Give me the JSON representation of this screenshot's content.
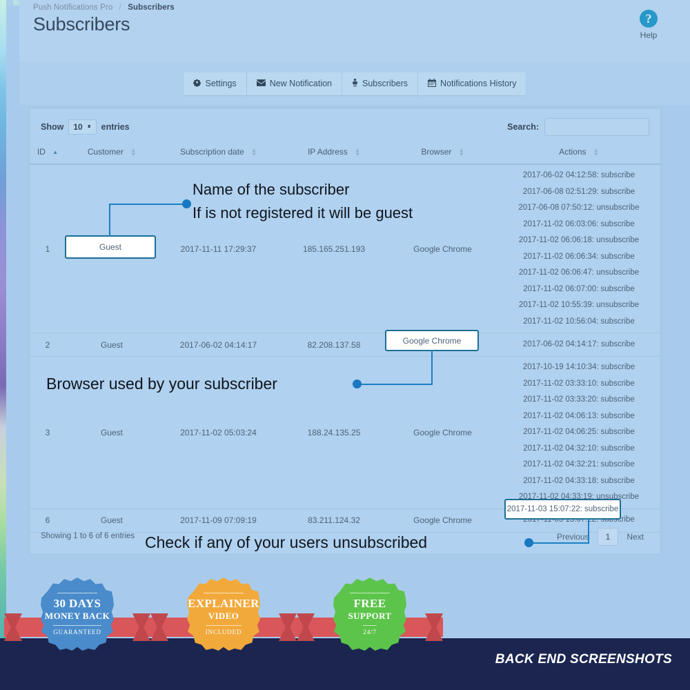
{
  "header": {
    "breadcrumb_parent": "Push Notifications Pro",
    "breadcrumb_sep": "/",
    "breadcrumb_current": "Subscribers",
    "title": "Subscribers",
    "help_glyph": "?",
    "help_label": "Help"
  },
  "toolbar": {
    "tabs": [
      {
        "label": "Settings",
        "icon": "gear-icon",
        "glyph": "⚙"
      },
      {
        "label": "New Notification",
        "icon": "envelope-icon",
        "glyph": "✉"
      },
      {
        "label": "Subscribers",
        "icon": "person-icon",
        "glyph": "!"
      },
      {
        "label": "Notifications History",
        "icon": "calendar-icon",
        "glyph": "☷"
      }
    ]
  },
  "table_controls": {
    "show_label": "Show",
    "entries_label": "entries",
    "page_length": "10",
    "search_label": "Search:",
    "search_value": "",
    "search_placeholder": ""
  },
  "table": {
    "columns": [
      {
        "label": "ID",
        "sort": "asc"
      },
      {
        "label": "Customer",
        "sort": "none"
      },
      {
        "label": "Subscription date",
        "sort": "none"
      },
      {
        "label": "IP Address",
        "sort": "none"
      },
      {
        "label": "Browser",
        "sort": "none"
      },
      {
        "label": "Actions",
        "sort": "none"
      }
    ],
    "rows": [
      {
        "id": "1",
        "customer": "Guest",
        "subscription_date": "2017-11-11 17:29:37",
        "ip": "185.165.251.193",
        "browser": "Google Chrome",
        "actions": [
          "2017-06-02 04:12:58: subscribe",
          "2017-06-08 02:51:29: subscribe",
          "2017-06-08 07:50:12: unsubscribe",
          "2017-11-02 06:03:06: subscribe",
          "2017-11-02 06:06:18: unsubscribe",
          "2017-11-02 06:06:34: subscribe",
          "2017-11-02 06:06:47: unsubscribe",
          "2017-11-02 06:07:00: subscribe",
          "2017-11-02 10:55:39: unsubscribe",
          "2017-11-02 10:56:04: subscribe"
        ]
      },
      {
        "id": "2",
        "customer": "Guest",
        "subscription_date": "2017-06-02 04:14:17",
        "ip": "82.208.137.58",
        "browser": "Google Chrome",
        "actions": [
          "2017-06-02 04:14:17: subscribe"
        ]
      },
      {
        "id": "3",
        "customer": "Guest",
        "subscription_date": "2017-11-02 05:03:24",
        "ip": "188.24.135.25",
        "browser": "Google Chrome",
        "actions": [
          "2017-10-19 14:10:34: subscribe",
          "2017-11-02 03:33:10: subscribe",
          "2017-11-02 03:33:20: subscribe",
          "2017-11-02 04:06:13: subscribe",
          "2017-11-02 04:06:25: subscribe",
          "2017-11-02 04:32:10: subscribe",
          "2017-11-02 04:32:21: subscribe",
          "2017-11-02 04:33:18: subscribe",
          "2017-11-02 04:33:19: unsubscribe"
        ]
      },
      {
        "id": "6",
        "customer": "Guest",
        "subscription_date": "2017-11-09 07:09:19",
        "ip": "83.211.124.32",
        "browser": "Google Chrome",
        "actions": [
          "2017-11-03 15:07:22: subscribe"
        ]
      }
    ]
  },
  "footer": {
    "showing": "Showing 1 to 6 of 6 entries",
    "previous": "Previous",
    "page_one": "1",
    "next": "Next"
  },
  "annotations": {
    "callout_customer_line1": "Name of the subscriber",
    "callout_customer_line2": "If is not registered it will be guest",
    "callout_browser": "Browser used by your subscriber",
    "callout_actions": "Check if any of your users unsubscribed",
    "highlight_customer_value": "Guest",
    "highlight_browser_value": "Google Chrome",
    "highlight_action_value": "2017-11-03 15:07:22: subscribe"
  },
  "promo": {
    "caption": "BACK END SCREENSHOTS",
    "badges": [
      {
        "line1": "30 DAYS",
        "line2": "MONEY BACK",
        "line3": "GUARANTEED",
        "color": "#4a8ccb"
      },
      {
        "line1": "EXPLAINER",
        "line2": "VIDEO",
        "line3": "INCLUDED",
        "color": "#f2a93b"
      },
      {
        "line1": "FREE",
        "line2": "SUPPORT",
        "line3": "24/7",
        "color": "#5cc44a"
      }
    ]
  },
  "colors": {
    "page_bg": "#a9cbeb",
    "panel_bg": "#b0d1ef",
    "accent": "#1b7fc4",
    "promo_bg": "#1b2550",
    "text": "#4f6276"
  }
}
